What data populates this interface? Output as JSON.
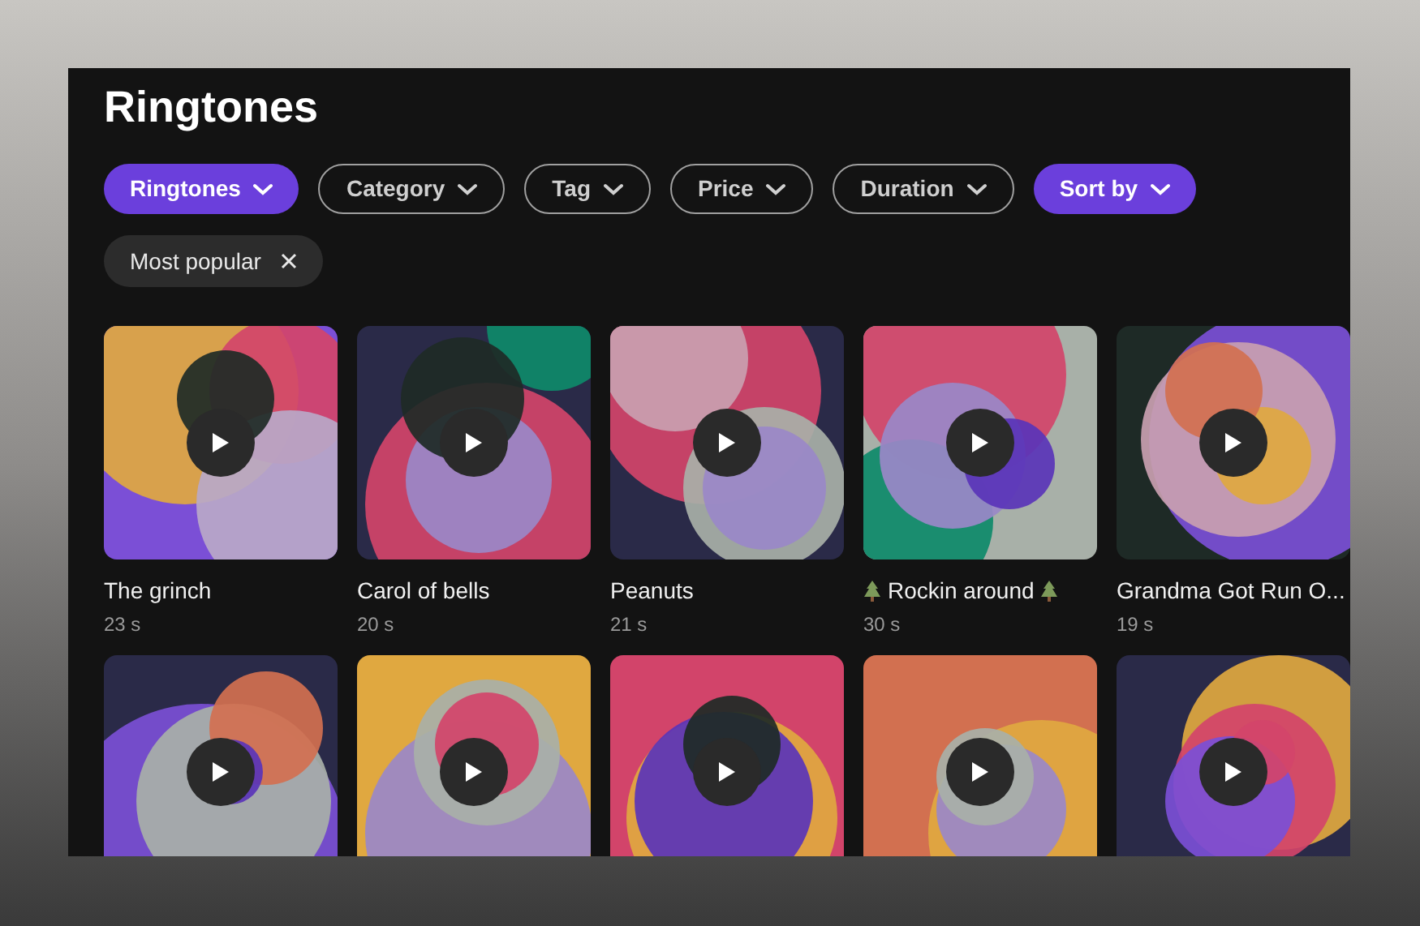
{
  "title": "Ringtones",
  "filters": [
    {
      "label": "Ringtones",
      "selected": true
    },
    {
      "label": "Category",
      "selected": false
    },
    {
      "label": "Tag",
      "selected": false
    },
    {
      "label": "Price",
      "selected": false
    },
    {
      "label": "Duration",
      "selected": false
    },
    {
      "label": "Sort by",
      "selected": true
    }
  ],
  "active_chips": [
    {
      "label": "Most popular"
    }
  ],
  "tracks": [
    {
      "title": "The grinch",
      "duration": "23 s"
    },
    {
      "title": "Carol of bells",
      "duration": "20 s"
    },
    {
      "title": "Peanuts",
      "duration": "21 s"
    },
    {
      "title": "Rockin around",
      "duration": "30 s",
      "kind": "festive"
    },
    {
      "title": "Grandma Got Run O...",
      "duration": "19 s"
    }
  ]
}
